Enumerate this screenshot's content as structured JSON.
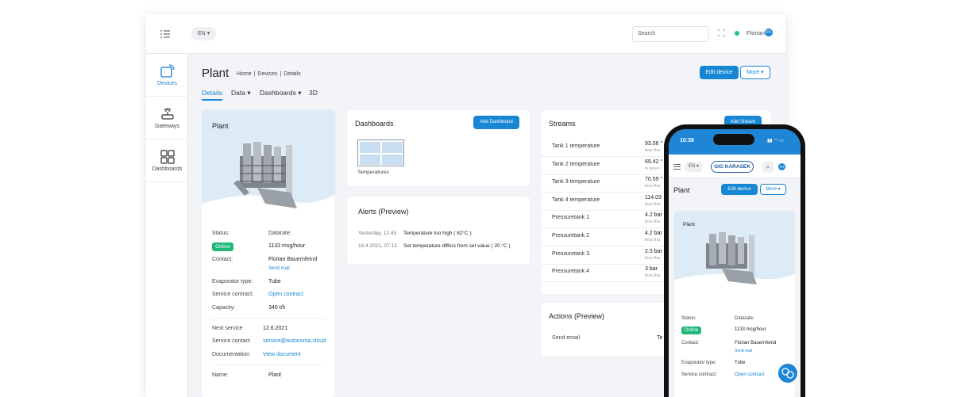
{
  "topbar": {
    "lang": "EN",
    "search_placeholder": "Search",
    "user": "Florian",
    "avatar": "FV"
  },
  "sidebar": {
    "items": [
      {
        "label": "Devices",
        "icon": "devices-icon"
      },
      {
        "label": "Gateways",
        "icon": "gateway-icon"
      },
      {
        "label": "Dashboards",
        "icon": "dashboard-grid-icon"
      }
    ]
  },
  "page": {
    "title": "Plant",
    "breadcrumb": [
      "Home",
      "Devices",
      "Details"
    ],
    "edit_label": "Edit device",
    "more_label": "More"
  },
  "tabs": [
    "Details",
    "Data",
    "Dashboards",
    "3D"
  ],
  "plant_card": {
    "title": "Plant",
    "status_label": "Status:",
    "status_value": "Online",
    "datarate_label": "Datarate:",
    "datarate_value": "1133 msg/hour",
    "contact_label": "Contact:",
    "contact_value": "Florian Bauernfeind",
    "send_mail": "Send mail",
    "evaporator_label": "Evaporator type:",
    "evaporator_value": "Tube",
    "contract_label": "Service contract:",
    "contract_value": "Open contract",
    "capacity_label": "Capacity:",
    "capacity_value": "340 t/h",
    "next_service_label": "Next service",
    "next_service_value": "12.6.2021",
    "service_contact_label": "Service contact",
    "service_contact_value": "service@autonoma.cloud",
    "documentation_label": "Documentation",
    "documentation_value": "View document",
    "name_label": "Name:",
    "name_value": "Plant"
  },
  "dashboards_card": {
    "title": "Dashboards",
    "add_label": "Add Dashboard",
    "thumb_label": "Temperatures"
  },
  "alerts_card": {
    "title": "Alerts (Preview)",
    "alerts": [
      {
        "time": "Yesterday, 12:45",
        "text": "Temperature too high ( 82°C )"
      },
      {
        "time": "19.4.2021, 07:13",
        "text": "Set temperature differs from set value ( 20 °C )"
      }
    ]
  },
  "streams_card": {
    "title": "Streams",
    "add_label": "Add Stream",
    "rows": [
      {
        "name": "Tank 1 temperature",
        "value": "93.06 °",
        "sub": "less tha"
      },
      {
        "name": "Tank 2 temperature",
        "value": "69.42 °",
        "sub": "in less t"
      },
      {
        "name": "Tank 3 temperature",
        "value": "70.59 °",
        "sub": "less tha"
      },
      {
        "name": "Tank 4 temperature",
        "value": "114.03",
        "sub": "less tha"
      },
      {
        "name": "Pressuretank 1",
        "value": "4.2 bar",
        "sub": "less tha"
      },
      {
        "name": "Pressuretank 2",
        "value": "4.2 bar",
        "sub": "less tha"
      },
      {
        "name": "Pressuretank 3",
        "value": "2.5 bar",
        "sub": "less tha"
      },
      {
        "name": "Pressuretank 4",
        "value": "3 bar",
        "sub": "less tha"
      }
    ]
  },
  "actions_card": {
    "title": "Actions (Preview)",
    "row_label": "Send email",
    "row_value": "Te"
  },
  "phone": {
    "time": "10:38",
    "lang": "EN",
    "logo": "GIG KARASEK",
    "avatar": "FV",
    "title": "Plant",
    "edit_label": "Edit device",
    "more_label": "More",
    "card_title": "Plant",
    "status_label": "Status:",
    "status_value": "Online",
    "datarate_label": "Datarate:",
    "datarate_value": "1133 msg/hour",
    "contact_label": "Contact:",
    "contact_value": "Florian Bauernfeind",
    "send_mail": "Send mail",
    "evaporator_label": "Evaporator type:",
    "evaporator_value": "Tube",
    "contract_label": "Service contract:",
    "contract_value": "Open contract"
  }
}
